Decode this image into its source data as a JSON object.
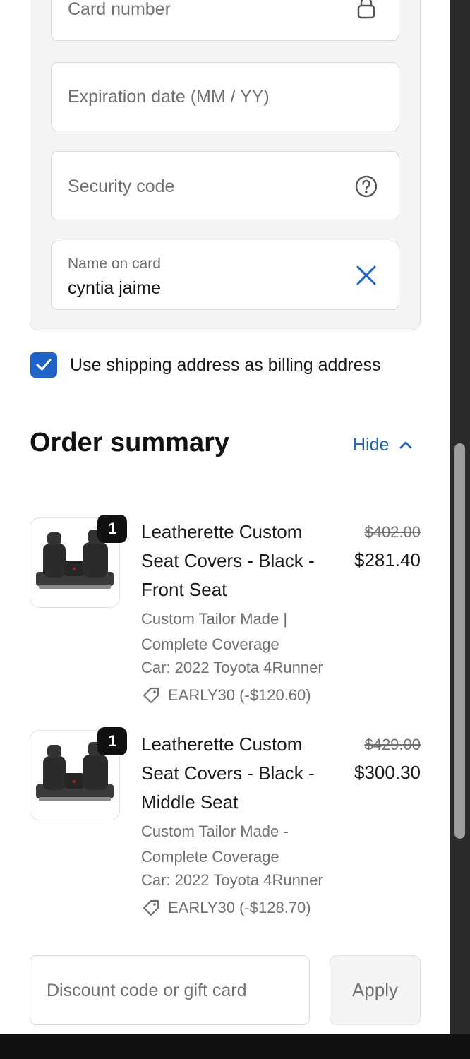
{
  "payment": {
    "card_number_placeholder": "Card number",
    "expiration_placeholder": "Expiration date (MM / YY)",
    "security_code_placeholder": "Security code",
    "name_on_card_label": "Name on card",
    "name_on_card_value": "cyntia jaime",
    "icons": {
      "card_number": "lock-icon",
      "security_code": "help-circle-icon",
      "name_on_card": "clear-x-icon"
    }
  },
  "billing": {
    "use_shipping_label": "Use shipping address as billing address",
    "checked": true
  },
  "order_summary": {
    "title": "Order summary",
    "toggle_label": "Hide",
    "toggle_icon": "chevron-up-icon",
    "items": [
      {
        "quantity": "1",
        "title": "Leatherette Custom Seat Covers - Black - Front Seat",
        "subtitle": "Custom Tailor Made | Complete Coverage",
        "car": "Car: 2022 Toyota 4Runner",
        "discount": "EARLY30 (-$120.60)",
        "original_price": "$402.00",
        "price": "$281.40"
      },
      {
        "quantity": "1",
        "title": "Leatherette Custom Seat Covers - Black - Middle Seat",
        "subtitle": "Custom Tailor Made - Complete Coverage",
        "car": "Car: 2022 Toyota 4Runner",
        "discount": "EARLY30 (-$128.70)",
        "original_price": "$429.00",
        "price": "$300.30"
      }
    ],
    "discount_placeholder": "Discount code or gift card",
    "apply_label": "Apply"
  },
  "colors": {
    "accent": "#1f63c8",
    "panel_bg": "#f4f4f4",
    "muted_text": "#707070"
  }
}
